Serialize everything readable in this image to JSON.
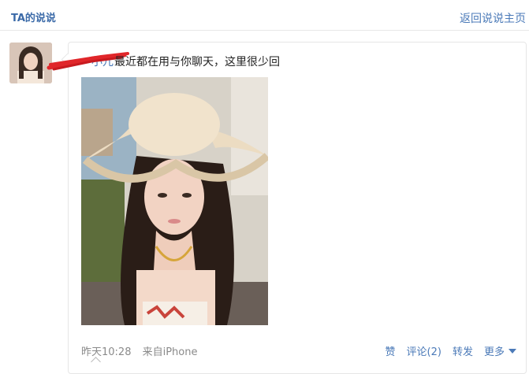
{
  "header": {
    "title": "TA的说说",
    "back_link": "返回说说主页"
  },
  "post": {
    "username": "小兀",
    "text": "最近都在用与你聊天，这里很少回",
    "time": "昨天10:28",
    "source": "来自iPhone",
    "actions": {
      "like": "赞",
      "comment": "评论(2)",
      "forward": "转发",
      "more": "更多"
    }
  },
  "colors": {
    "link": "#4b7ab8",
    "title": "#3b6aa8",
    "redaction": "#e0262a"
  }
}
